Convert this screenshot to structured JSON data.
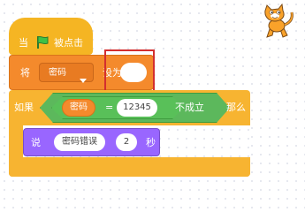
{
  "hat": {
    "prefix": "当",
    "suffix": "被点击",
    "flag_color": "#3fc146"
  },
  "set_var": {
    "label_set": "将",
    "dropdown_value": "密码",
    "label_to": "设为",
    "value": ""
  },
  "if_block": {
    "label_if": "如果",
    "var_reporter": "密码",
    "operator": "=",
    "compare_value": "12345",
    "suffix": "不成立",
    "label_then": "那么"
  },
  "say_block": {
    "label": "说",
    "message": "密码错误",
    "seconds": "2",
    "unit": "秒"
  },
  "colors": {
    "events": "#f5b523",
    "variables": "#f48a2c",
    "operators": "#5cb85c",
    "control": "#f7b431",
    "looks": "#9966ff",
    "highlight_box": "#d32f2f"
  },
  "sprite": {
    "icon": "scratch-cat-icon"
  }
}
